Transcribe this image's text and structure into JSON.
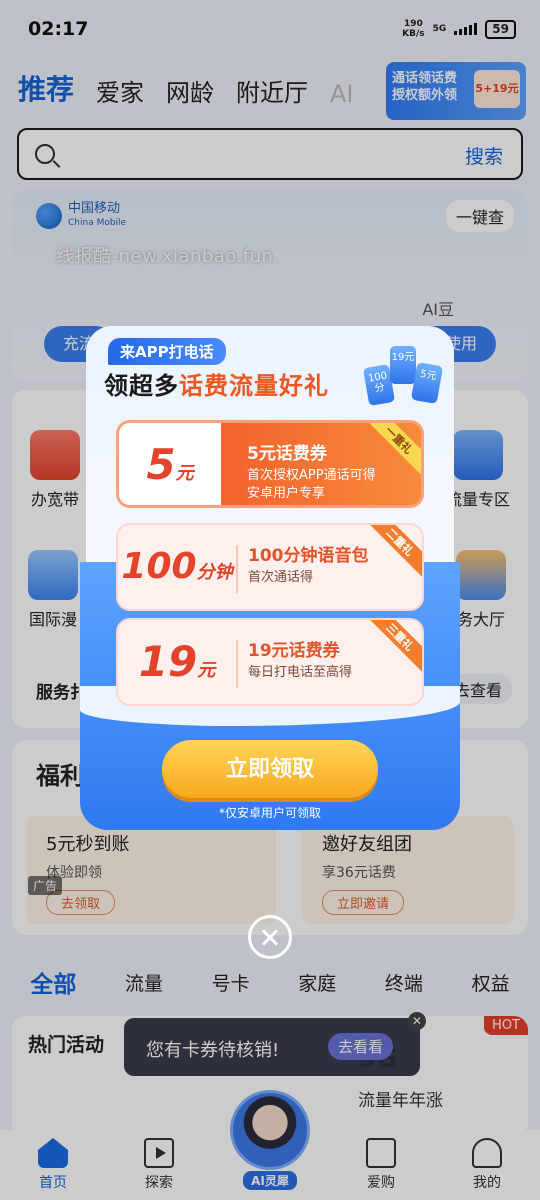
{
  "status_bar": {
    "time": "02:17",
    "net_speed": "190",
    "net_unit": "KB/s",
    "network": "5G",
    "battery": "59"
  },
  "top_tabs": [
    {
      "label": "推荐"
    },
    {
      "label": "爱家"
    },
    {
      "label": "网龄"
    },
    {
      "label": "附近厅"
    },
    {
      "label": "AI"
    }
  ],
  "top_promo": {
    "line1": "通话领话费",
    "line2": "授权额外领",
    "chip": "5+19元"
  },
  "search": {
    "button": "搜索"
  },
  "cm_card": {
    "logo_cn": "中国移动",
    "logo_en": "China Mobile",
    "one_key": "一键查",
    "pill_left": "充流",
    "pill_right": "去使用",
    "ai_label": "AI豆"
  },
  "watermark": "线报酷-new.xianbao.fun",
  "services": {
    "items": [
      {
        "label": "办宽带"
      },
      {
        "label": "流量专区"
      },
      {
        "label": "国际漫"
      },
      {
        "label": "务大厅"
      }
    ],
    "service_label": "服务扌",
    "view_label": "去查看"
  },
  "welfare": {
    "title": "福利",
    "card1": {
      "title": "5元秒到账",
      "sub": "体验即领",
      "btn": "去领取"
    },
    "card2": {
      "title": "邀好友组团",
      "sub": "享36元话费",
      "btn": "立即邀请"
    },
    "ad": "广告"
  },
  "category_tabs": [
    {
      "label": "全部"
    },
    {
      "label": "流量"
    },
    {
      "label": "号卡"
    },
    {
      "label": "家庭"
    },
    {
      "label": "终端"
    },
    {
      "label": "权益"
    }
  ],
  "hot": {
    "title": "热门活动",
    "badge": "HOT",
    "big": "5G",
    "sub": "流量年年涨"
  },
  "toast": {
    "text": "您有卡券待核销!",
    "button": "去看看"
  },
  "bottom_nav": [
    {
      "label": "首页"
    },
    {
      "label": "探索"
    },
    {
      "label": "爱购"
    },
    {
      "label": "我的"
    }
  ],
  "ai_assistant": {
    "label": "AI灵犀"
  },
  "popup": {
    "pill": "来APP打电话",
    "heading_prefix": "领超多",
    "heading_highlight": "话费流量好礼",
    "mini_tickets": [
      "100分",
      "19元",
      "5元"
    ],
    "tickets": [
      {
        "amount": "5",
        "unit": "元",
        "title": "5元话费券",
        "desc1": "首次授权APP通话可得",
        "desc2": "安卓用户专享",
        "corner": "一重礼"
      },
      {
        "amount": "100",
        "unit": "分钟",
        "title": "100分钟语音包",
        "desc1": "首次通话得",
        "desc2": "",
        "corner": "二重礼"
      },
      {
        "amount": "19",
        "unit": "元",
        "title": "19元话费券",
        "desc1": "每日打电话至高得",
        "desc2": "",
        "corner": "三重礼"
      }
    ],
    "claim_button": "立即领取",
    "note": "*仅安卓用户可领取"
  }
}
